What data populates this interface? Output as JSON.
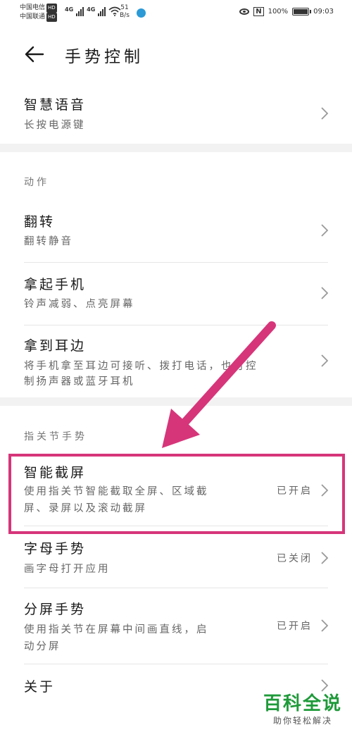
{
  "status_bar": {
    "carrier_1": "中国电信",
    "carrier_2": "中国联通",
    "hd_1": "HD",
    "hd_2": "HD",
    "net_1": "4G",
    "net_2": "4G",
    "speed_value": "51",
    "speed_unit": "B/s",
    "battery": "100%",
    "time": "09:03"
  },
  "header": {
    "title": "手势控制"
  },
  "items": {
    "voice": {
      "title": "智慧语音",
      "subtitle": "长按电源键"
    },
    "flip": {
      "title": "翻转",
      "subtitle": "翻转静音"
    },
    "pickup": {
      "title": "拿起手机",
      "subtitle": "铃声减弱、点亮屏幕"
    },
    "ear": {
      "title": "拿到耳边",
      "subtitle_line1": "将手机拿至耳边可接听、拨打电话，也可控",
      "subtitle_line2": "制扬声器或蓝牙耳机"
    },
    "smart_screenshot": {
      "title": "智能截屏",
      "subtitle_line1": "使用指关节智能截取全屏、区域截",
      "subtitle_line2": "屏、录屏以及滚动截屏",
      "status": "已开启"
    },
    "letter": {
      "title": "字母手势",
      "subtitle": "画字母打开应用",
      "status": "已关闭"
    },
    "split": {
      "title": "分屏手势",
      "subtitle_line1": "使用指关节在屏幕中间画直线，启",
      "subtitle_line2": "动分屏",
      "status": "已开启"
    },
    "about": {
      "title": "关于"
    }
  },
  "sections": {
    "actions": "动作",
    "knuckle": "指关节手势"
  },
  "annotation": {
    "color": "#d6357a"
  },
  "watermark": {
    "brand": "百科全说",
    "tagline": "助你轻松解决"
  }
}
